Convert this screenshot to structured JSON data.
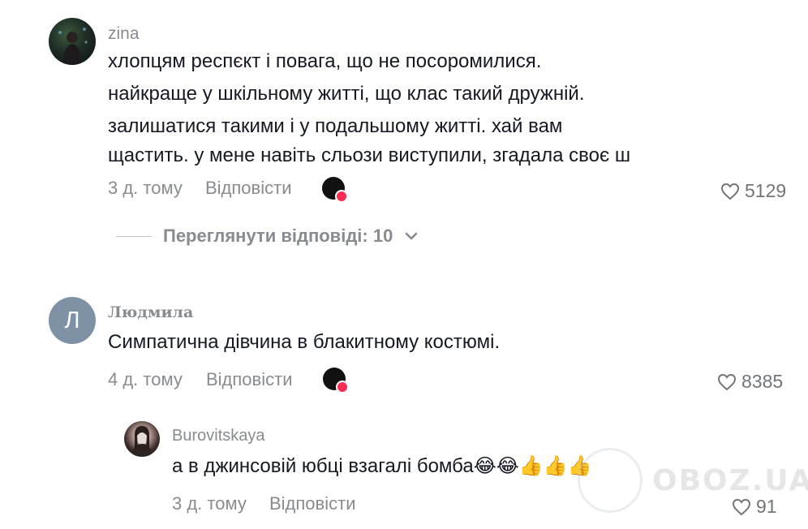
{
  "comments": [
    {
      "username": "zina",
      "lines": [
        "хлопцям респєкт і повага, що не посоромилися.",
        "найкраще у шкільному житті, що клас такий дружній.",
        "залишатися такими і у подальшому житті. хай вам",
        "щастить. у мене навіть сльози виступили, згадала своє ш"
      ],
      "time": "3 д. тому",
      "reply_label": "Відповісти",
      "likes": "5129"
    },
    {
      "username": "Людмила",
      "avatar_letter": "Л",
      "lines": [
        "Симпатична дівчина в блакитному костюмі."
      ],
      "time": "4 д. тому",
      "reply_label": "Відповісти",
      "likes": "8385"
    }
  ],
  "view_replies": {
    "label": "Переглянути відповіді: 10"
  },
  "reply": {
    "username": "Burovitskaya",
    "text": "а в джинсовій юбці взагалі бомба😂😂👍👍👍",
    "time": "3 д. тому",
    "reply_label": "Відповісти",
    "likes": "91"
  },
  "watermark": {
    "text": "OBOZ.UA"
  },
  "colors": {
    "text_primary": "#161823",
    "text_secondary": "#8a8b91",
    "creator_heart": "#fe2c55",
    "avatar_letter_bg": "#7f92a5"
  }
}
